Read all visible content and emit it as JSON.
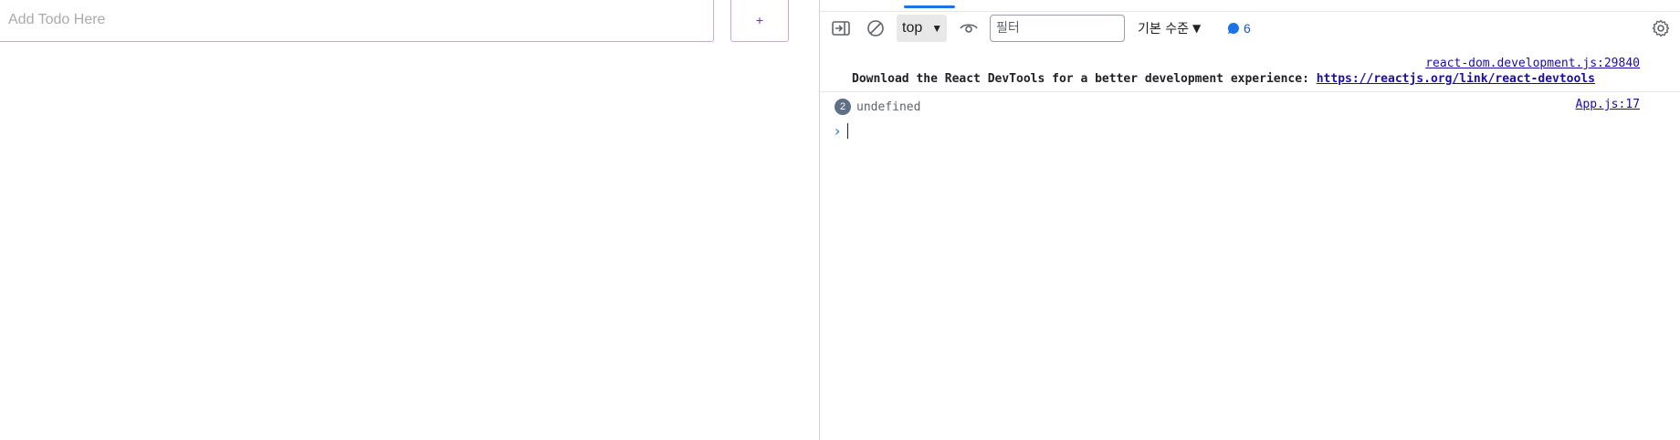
{
  "app": {
    "todo_placeholder": "Add Todo Here",
    "add_button_label": "+"
  },
  "devtools": {
    "toolbar": {
      "context": "top",
      "filter_placeholder": "필터",
      "levels_label": "기본 수준",
      "message_count": "6"
    },
    "console": {
      "messages": [
        {
          "source": "react-dom.development.js:29840",
          "text": "Download the React DevTools for a better development experience: ",
          "link": "https://reactjs.org/link/react-devtools"
        },
        {
          "repeat_count": "2",
          "text": "undefined",
          "source": "App.js:17"
        }
      ],
      "prompt_symbol": "›"
    },
    "colors": {
      "accent": "#1a73e8",
      "link": "#1a0dab",
      "button_text": "#7b2fa3"
    }
  }
}
